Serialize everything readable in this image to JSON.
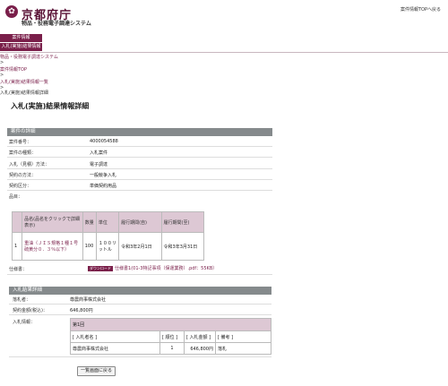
{
  "header": {
    "logo_mark": "✿",
    "logo_text": "京都府庁",
    "subtitle": "物品・役務電子調達システム",
    "back_top_link": "案件情報TOPへ戻る"
  },
  "nav": {
    "item1": "案件情報",
    "item2": "入札(実施)結果情報"
  },
  "breadcrumb": {
    "crumb1": "物品・役務電子調達システム",
    "sep": ">",
    "crumb2": "案件情報TOP",
    "crumb3": "入札(実施)結果情報一覧",
    "current": "入札(実施)結果情報詳細"
  },
  "page_title": "入札(実施)結果情報詳細",
  "case_details": {
    "header": "案件の詳細",
    "rows": [
      {
        "label": "案件番号：",
        "value": "4000054588"
      },
      {
        "label": "案件の種類：",
        "value": "入札案件"
      },
      {
        "label": "入札（見積）方法：",
        "value": "電子調達"
      },
      {
        "label": "契約の方法：",
        "value": "一般競争入札"
      },
      {
        "label": "契約区分：",
        "value": "単価契約用品"
      },
      {
        "label": "品目：",
        "value": ""
      }
    ]
  },
  "items_table": {
    "headers": [
      "",
      "品名(品名をクリックで詳細表示)",
      "数量",
      "単位",
      "履行期間(自)",
      "履行期間(至)"
    ],
    "rows": [
      {
        "no": "1",
        "name": "重油（ＪＩＳ規格１種１号硫黄分０．３％以下）",
        "qty": "100",
        "unit": "１００リットル",
        "from": "令和3年2月1日",
        "to": "令和3年3月31日"
      }
    ]
  },
  "spec": {
    "label": "仕様書：",
    "badge": "ダウンロード",
    "link": "仕様書1(01-3特記事項（保運業務）.pdf：55KB）"
  },
  "result": {
    "header": "入札結果詳細",
    "winner_label": "落札者：",
    "winner": "尊農商事株式会社",
    "amount_label": "契約金額(税込)：",
    "amount": "646,800円",
    "bid_info_label": "入札情報：",
    "round": "第1回",
    "bid_headers": [
      "[ 入札者名 ]",
      "[ 順位 ]",
      "[ 入札金額 ]",
      "[ 備考 ]"
    ],
    "bids": [
      {
        "name": "尊農商事株式会社",
        "rank": "1",
        "amount": "646,800円",
        "note": "落札"
      }
    ]
  },
  "back_button": "一覧画面に戻る"
}
